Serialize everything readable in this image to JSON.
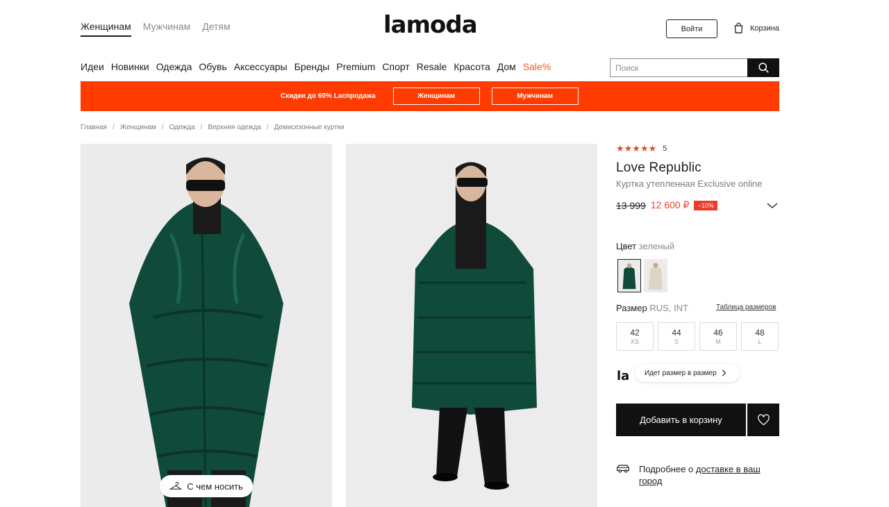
{
  "header": {
    "gender_tabs": [
      "Женщинам",
      "Мужчинам",
      "Детям"
    ],
    "logo": "lamoda",
    "login_label": "Войти",
    "cart_label": "Корзина"
  },
  "menu": {
    "items": [
      "Идеи",
      "Новинки",
      "Одежда",
      "Обувь",
      "Аксессуары",
      "Бренды",
      "Premium",
      "Спорт",
      "Resale",
      "Красота",
      "Дом"
    ],
    "sale_label": "Sale%"
  },
  "search": {
    "placeholder": "Поиск"
  },
  "banner": {
    "text": "Скидки до 60% Lаспродажа",
    "women_button": "Женщинам",
    "men_button": "Мужчинам",
    "color": "#ff3b00"
  },
  "breadcrumb": [
    "Главная",
    "Женщинам",
    "Одежда",
    "Верхняя одежда",
    "Демисезонные куртки"
  ],
  "gallery": {
    "wear_button": "С чем носить"
  },
  "product": {
    "stars": "★★★★★",
    "rating": "5",
    "brand": "Love Republic",
    "name": "Куртка утепленная Exclusive online",
    "old_price": "13 999",
    "price": "12 600 ₽",
    "discount": "−10%",
    "color_label": "Цвет",
    "color_value": "зеленый",
    "size_label": "Размер",
    "size_system": "RUS, INT",
    "size_table_link": "Таблица размеров",
    "sizes": [
      {
        "ru": "42",
        "int": "XS"
      },
      {
        "ru": "44",
        "int": "S"
      },
      {
        "ru": "46",
        "int": "M"
      },
      {
        "ru": "48",
        "int": "L"
      }
    ],
    "fit_mark": "la",
    "fit_text": "Идет размер в размер",
    "add_to_cart": "Добавить в корзину",
    "delivery_prefix": "Подробнее о ",
    "delivery_link": "доставке в ваш город"
  },
  "colors": {
    "accent": "#ff3b00",
    "price": "#e6452a",
    "jacket": "#0f4a3a"
  }
}
